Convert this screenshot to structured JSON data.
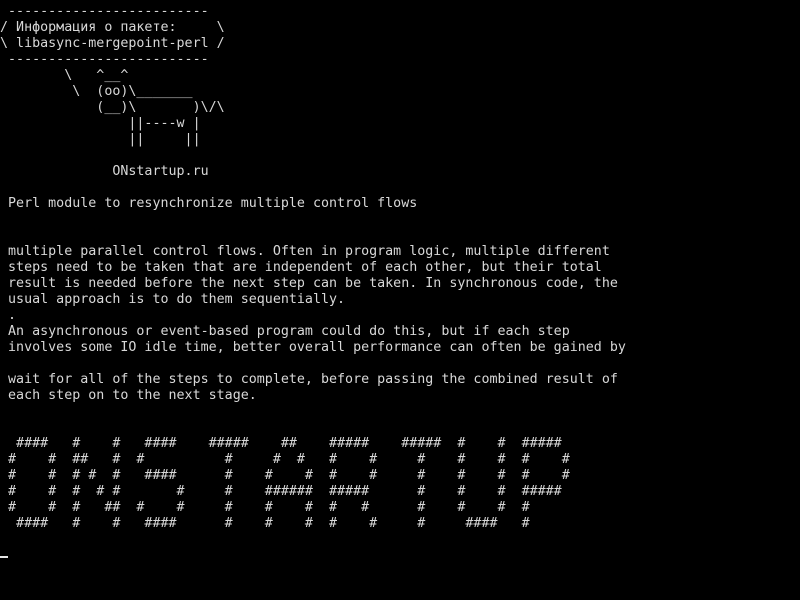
{
  "terminal": {
    "bg": "#000000",
    "fg": "#d8d8d8",
    "lines": [
      " -------------------------",
      "/ Информация о пакете:     \\",
      "\\ libasync-mergepoint-perl /",
      " -------------------------",
      "        \\   ^__^",
      "         \\  (oo)\\_______",
      "            (__)\\       )\\/\\",
      "                ||----w |",
      "                ||     ||",
      "",
      "              ONstartup.ru",
      "",
      " Perl module to resynchronize multiple control flows",
      "",
      "",
      " multiple parallel control flows. Often in program logic, multiple different",
      " steps need to be taken that are independent of each other, but their total",
      " result is needed before the next step can be taken. In synchronous code, the",
      " usual approach is to do them sequentially.",
      " .",
      " An asynchronous or event-based program could do this, but if each step",
      " involves some IO idle time, better overall performance can often be gained by",
      "",
      " wait for all of the steps to complete, before passing the combined result of",
      " each step on to the next stage.",
      "",
      "",
      "  ####   #    #   ####    #####    ##    #####    #####  #    #  #####",
      " #    #  ##   #  #          #     #  #   #    #     #    #    #  #    #",
      " #    #  # #  #   ####      #    #    #  #    #     #    #    #  #    #",
      " #    #  #  # #       #     #    ######  #####      #    #    #  #####",
      " #    #  #   ##  #    #     #    #    #  #   #      #    #    #  #",
      "  ####   #    #   ####      #    #    #  #    #     #     ####   #"
    ]
  }
}
